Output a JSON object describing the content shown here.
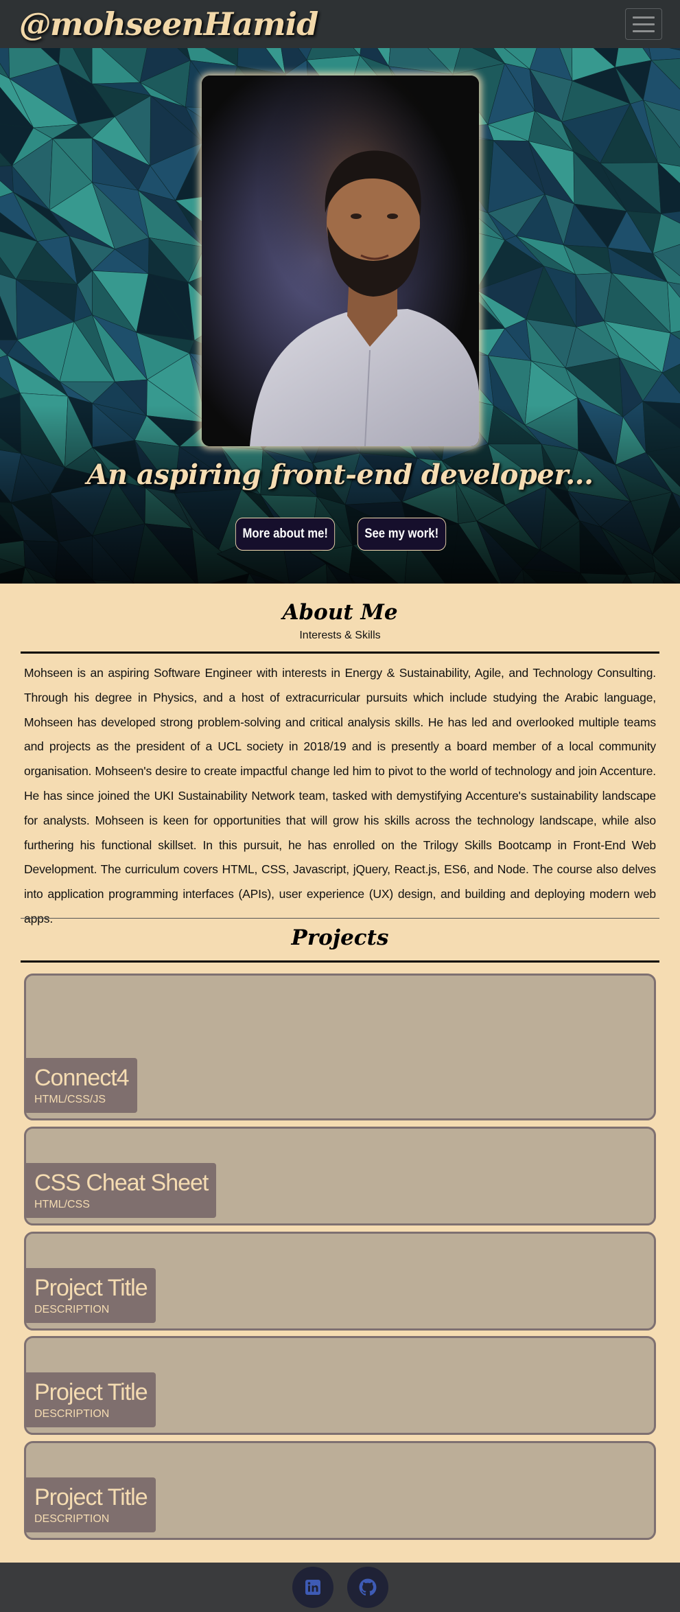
{
  "navbar": {
    "brand": "@mohseenHamid",
    "menu_icon": "hamburger-menu-icon"
  },
  "hero": {
    "tagline": "An aspiring front-end developer...",
    "buttons": [
      "More about me!",
      "See my work!"
    ]
  },
  "about": {
    "title": "About Me",
    "subtitle": "Interests & Skills",
    "body": "Mohseen is an aspiring Software Engineer with interests in Energy & Sustainability, Agile, and Technology Consulting. Through his degree in Physics, and a host of extracurricular pursuits which include studying the Arabic language, Mohseen has developed strong problem-solving and critical analysis skills. He has led and overlooked multiple teams and projects as the president of a UCL society in 2018/19 and is presently a board member of a local community organisation. Mohseen's desire to create impactful change led him to pivot to the world of technology and join Accenture. He has since joined the UKI Sustainability Network team, tasked with demystifying Accenture's sustainability landscape for analysts. Mohseen is keen for opportunities that will grow his skills across the technology landscape, while also furthering his functional skillset. In this pursuit, he has enrolled on the Trilogy Skills Bootcamp in Front-End Web Development. The curriculum covers HTML, CSS, Javascript, jQuery, React.js, ES6, and Node. The course also delves into application programming interfaces (APIs), user experience (UX) design, and building and deploying modern web apps."
  },
  "projects": {
    "title": "Projects",
    "items": [
      {
        "title": "Connect4",
        "description": "HTML/CSS/JS"
      },
      {
        "title": "CSS Cheat Sheet",
        "description": "HTML/CSS"
      },
      {
        "title": "Project Title",
        "description": "DESCRIPTION"
      },
      {
        "title": "Project Title",
        "description": "DESCRIPTION"
      },
      {
        "title": "Project Title",
        "description": "DESCRIPTION"
      }
    ]
  },
  "footer": {
    "links": [
      "linkedin-icon",
      "github-icon"
    ]
  },
  "colors": {
    "navbar": "#2e3234",
    "page_background": "#f5dcb2",
    "card": "#bcae98",
    "card_label": "#7f6f6e",
    "button_background": "#160f2c",
    "footer": "#3a3b3d",
    "social_icon": "#1f2236",
    "social_glyph": "#3e5bb5"
  }
}
